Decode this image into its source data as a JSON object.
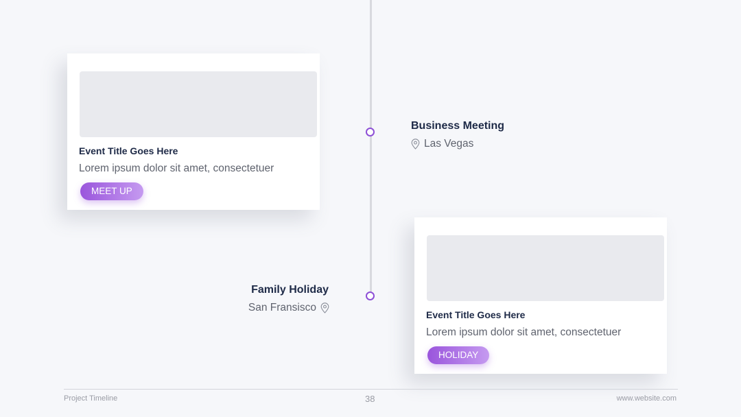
{
  "colors": {
    "accent": "#8d4fd6",
    "title": "#1e2a47",
    "body_text": "#5f636e",
    "background": "#f6f7fa"
  },
  "events": [
    {
      "title": "Business Meeting",
      "location": "Las Vegas",
      "location_icon": "map-pin-icon",
      "card": {
        "title": "Event Title Goes Here",
        "description": "Lorem ipsum dolor sit amet, consectetuer",
        "tag": "MEET UP"
      }
    },
    {
      "title": "Family Holiday",
      "location": "San Fransisco",
      "location_icon": "map-pin-icon",
      "card": {
        "title": "Event Title Goes Here",
        "description": "Lorem ipsum dolor sit amet, consectetuer",
        "tag": "HOLIDAY"
      }
    }
  ],
  "footer": {
    "left": "Project Timeline",
    "page_number": "38",
    "right": "www.website.com"
  }
}
